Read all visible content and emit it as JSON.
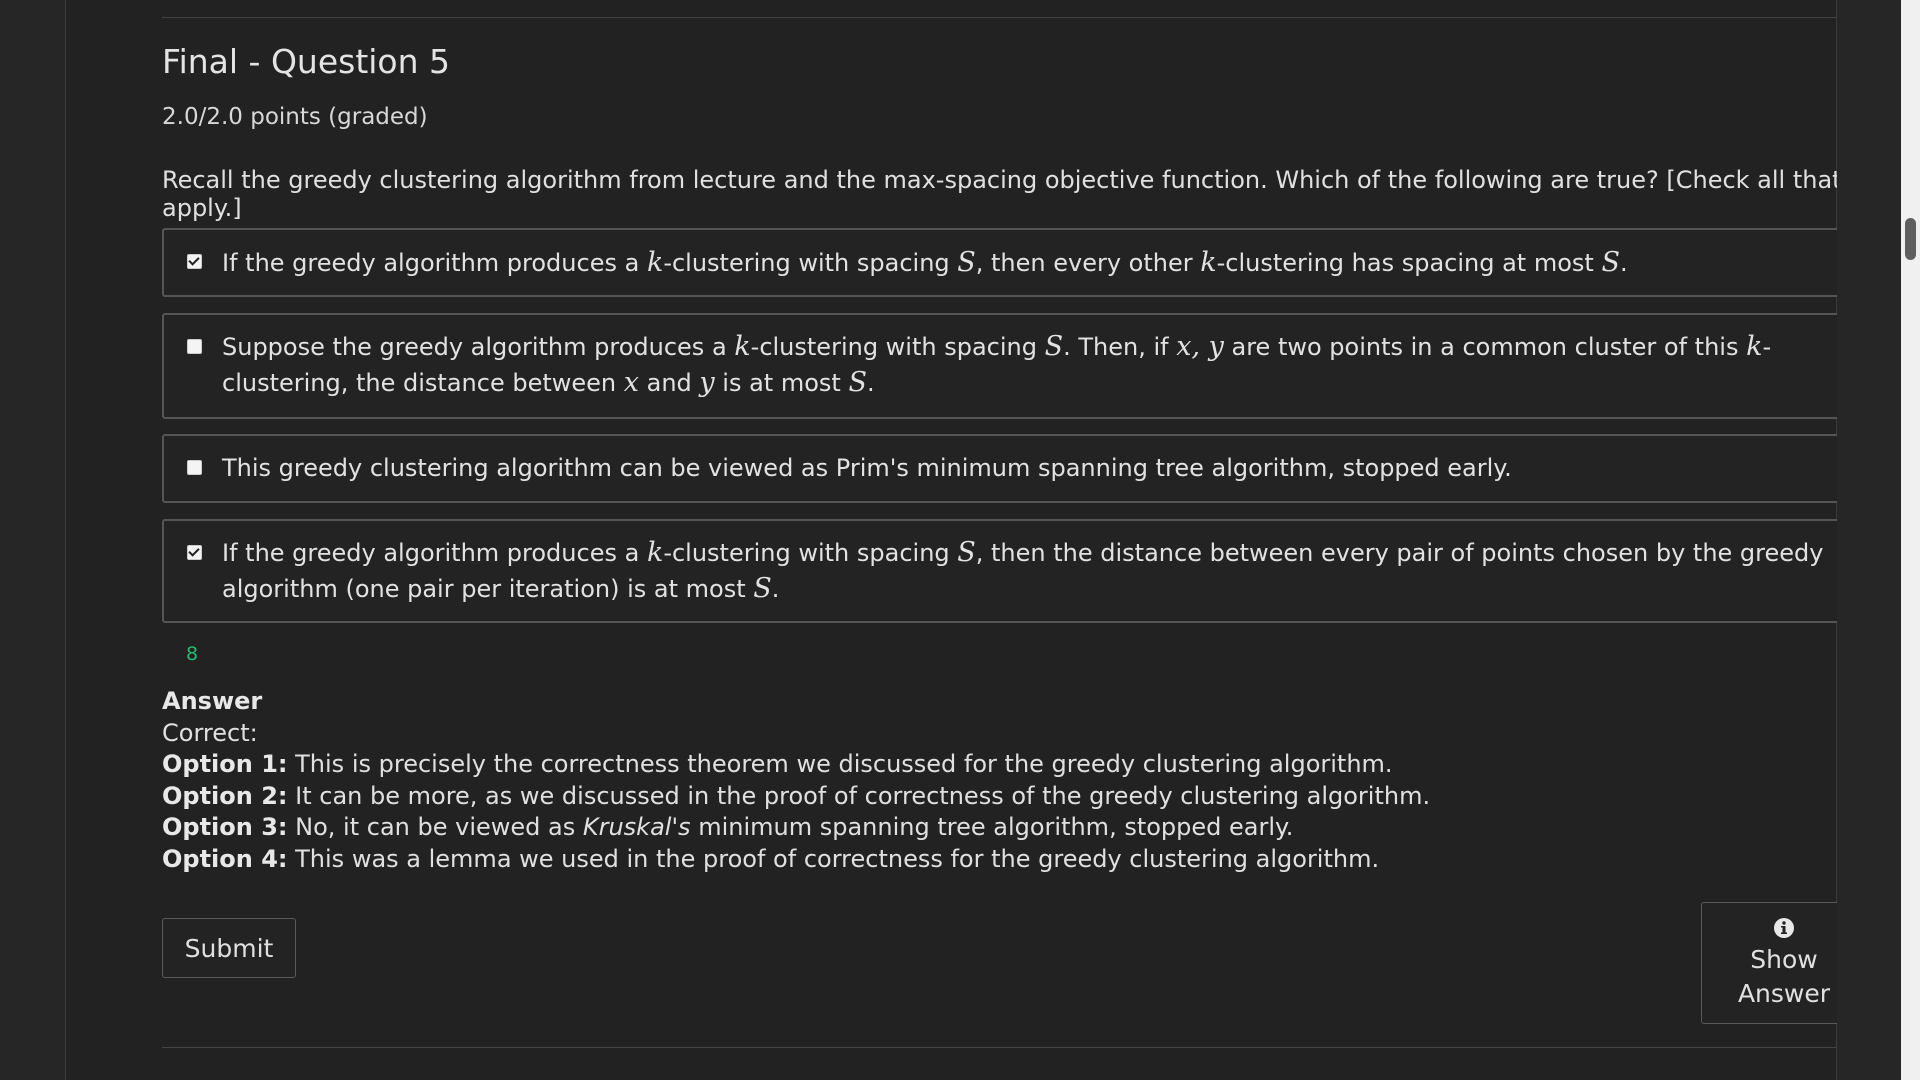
{
  "problem": {
    "title": "Final - Question 5",
    "points": "2.0/2.0 points (graded)",
    "question": "Recall the greedy clustering algorithm from lecture and the max-spacing objective function. Which of the following are true? [Check all that apply.]"
  },
  "choices": [
    {
      "checked": true,
      "parts": [
        "If the greedy algorithm produces a ",
        "k",
        "-clustering with spacing ",
        "S",
        ", then every other ",
        "k",
        "-clustering has spacing at most ",
        "S",
        "."
      ]
    },
    {
      "checked": false,
      "parts": [
        "Suppose the greedy algorithm produces a ",
        "k",
        "-clustering with spacing ",
        "S",
        ". Then, if ",
        "x, y",
        " are two points in a common cluster of this ",
        "k",
        "-clustering, the distance between ",
        "x",
        " and ",
        "y",
        " is at most ",
        "S",
        "."
      ]
    },
    {
      "checked": false,
      "parts": [
        "This greedy clustering algorithm can be viewed as Prim's minimum spanning tree algorithm, stopped early."
      ]
    },
    {
      "checked": true,
      "parts": [
        "If the greedy algorithm produces a ",
        "k",
        "-clustering with spacing ",
        "S",
        ", then the distance between every pair of points chosen by the greedy algorithm (one pair per iteration) is at most ",
        "S",
        "."
      ]
    }
  ],
  "status_number": "8",
  "answer": {
    "heading": "Answer",
    "correct_label": "Correct:",
    "options": [
      {
        "label": "Option 1:",
        "text": " This is precisely the correctness theorem we discussed for the greedy clustering algorithm."
      },
      {
        "label": "Option 2:",
        "text": " It can be more, as we discussed in the proof of correctness of the greedy clustering algorithm."
      },
      {
        "label": "Option 3:",
        "text_before": " No, it can be viewed as ",
        "emphasis": "Kruskal's",
        "text_after": " minimum spanning tree algorithm, stopped early."
      },
      {
        "label": "Option 4:",
        "text": " This was a lemma we used in the proof of correctness for the greedy clustering algorithm."
      }
    ]
  },
  "buttons": {
    "submit": "Submit",
    "show_answer_line1": "Show",
    "show_answer_line2": "Answer"
  },
  "icons": {
    "show_answer": "info-icon"
  },
  "colors": {
    "status_number": "#2bb673",
    "panel_background": "#222222"
  }
}
